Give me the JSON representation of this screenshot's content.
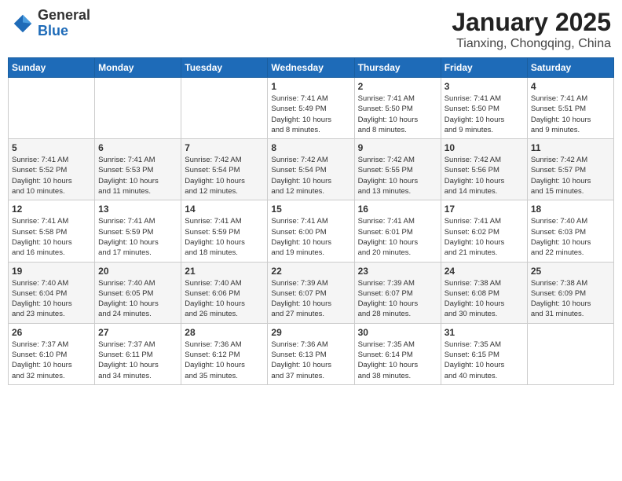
{
  "header": {
    "logo_general": "General",
    "logo_blue": "Blue",
    "title": "January 2025",
    "subtitle": "Tianxing, Chongqing, China"
  },
  "calendar": {
    "weekdays": [
      "Sunday",
      "Monday",
      "Tuesday",
      "Wednesday",
      "Thursday",
      "Friday",
      "Saturday"
    ],
    "weeks": [
      [
        {
          "day": "",
          "info": ""
        },
        {
          "day": "",
          "info": ""
        },
        {
          "day": "",
          "info": ""
        },
        {
          "day": "1",
          "info": "Sunrise: 7:41 AM\nSunset: 5:49 PM\nDaylight: 10 hours\nand 8 minutes."
        },
        {
          "day": "2",
          "info": "Sunrise: 7:41 AM\nSunset: 5:50 PM\nDaylight: 10 hours\nand 8 minutes."
        },
        {
          "day": "3",
          "info": "Sunrise: 7:41 AM\nSunset: 5:50 PM\nDaylight: 10 hours\nand 9 minutes."
        },
        {
          "day": "4",
          "info": "Sunrise: 7:41 AM\nSunset: 5:51 PM\nDaylight: 10 hours\nand 9 minutes."
        }
      ],
      [
        {
          "day": "5",
          "info": "Sunrise: 7:41 AM\nSunset: 5:52 PM\nDaylight: 10 hours\nand 10 minutes."
        },
        {
          "day": "6",
          "info": "Sunrise: 7:41 AM\nSunset: 5:53 PM\nDaylight: 10 hours\nand 11 minutes."
        },
        {
          "day": "7",
          "info": "Sunrise: 7:42 AM\nSunset: 5:54 PM\nDaylight: 10 hours\nand 12 minutes."
        },
        {
          "day": "8",
          "info": "Sunrise: 7:42 AM\nSunset: 5:54 PM\nDaylight: 10 hours\nand 12 minutes."
        },
        {
          "day": "9",
          "info": "Sunrise: 7:42 AM\nSunset: 5:55 PM\nDaylight: 10 hours\nand 13 minutes."
        },
        {
          "day": "10",
          "info": "Sunrise: 7:42 AM\nSunset: 5:56 PM\nDaylight: 10 hours\nand 14 minutes."
        },
        {
          "day": "11",
          "info": "Sunrise: 7:42 AM\nSunset: 5:57 PM\nDaylight: 10 hours\nand 15 minutes."
        }
      ],
      [
        {
          "day": "12",
          "info": "Sunrise: 7:41 AM\nSunset: 5:58 PM\nDaylight: 10 hours\nand 16 minutes."
        },
        {
          "day": "13",
          "info": "Sunrise: 7:41 AM\nSunset: 5:59 PM\nDaylight: 10 hours\nand 17 minutes."
        },
        {
          "day": "14",
          "info": "Sunrise: 7:41 AM\nSunset: 5:59 PM\nDaylight: 10 hours\nand 18 minutes."
        },
        {
          "day": "15",
          "info": "Sunrise: 7:41 AM\nSunset: 6:00 PM\nDaylight: 10 hours\nand 19 minutes."
        },
        {
          "day": "16",
          "info": "Sunrise: 7:41 AM\nSunset: 6:01 PM\nDaylight: 10 hours\nand 20 minutes."
        },
        {
          "day": "17",
          "info": "Sunrise: 7:41 AM\nSunset: 6:02 PM\nDaylight: 10 hours\nand 21 minutes."
        },
        {
          "day": "18",
          "info": "Sunrise: 7:40 AM\nSunset: 6:03 PM\nDaylight: 10 hours\nand 22 minutes."
        }
      ],
      [
        {
          "day": "19",
          "info": "Sunrise: 7:40 AM\nSunset: 6:04 PM\nDaylight: 10 hours\nand 23 minutes."
        },
        {
          "day": "20",
          "info": "Sunrise: 7:40 AM\nSunset: 6:05 PM\nDaylight: 10 hours\nand 24 minutes."
        },
        {
          "day": "21",
          "info": "Sunrise: 7:40 AM\nSunset: 6:06 PM\nDaylight: 10 hours\nand 26 minutes."
        },
        {
          "day": "22",
          "info": "Sunrise: 7:39 AM\nSunset: 6:07 PM\nDaylight: 10 hours\nand 27 minutes."
        },
        {
          "day": "23",
          "info": "Sunrise: 7:39 AM\nSunset: 6:07 PM\nDaylight: 10 hours\nand 28 minutes."
        },
        {
          "day": "24",
          "info": "Sunrise: 7:38 AM\nSunset: 6:08 PM\nDaylight: 10 hours\nand 30 minutes."
        },
        {
          "day": "25",
          "info": "Sunrise: 7:38 AM\nSunset: 6:09 PM\nDaylight: 10 hours\nand 31 minutes."
        }
      ],
      [
        {
          "day": "26",
          "info": "Sunrise: 7:37 AM\nSunset: 6:10 PM\nDaylight: 10 hours\nand 32 minutes."
        },
        {
          "day": "27",
          "info": "Sunrise: 7:37 AM\nSunset: 6:11 PM\nDaylight: 10 hours\nand 34 minutes."
        },
        {
          "day": "28",
          "info": "Sunrise: 7:36 AM\nSunset: 6:12 PM\nDaylight: 10 hours\nand 35 minutes."
        },
        {
          "day": "29",
          "info": "Sunrise: 7:36 AM\nSunset: 6:13 PM\nDaylight: 10 hours\nand 37 minutes."
        },
        {
          "day": "30",
          "info": "Sunrise: 7:35 AM\nSunset: 6:14 PM\nDaylight: 10 hours\nand 38 minutes."
        },
        {
          "day": "31",
          "info": "Sunrise: 7:35 AM\nSunset: 6:15 PM\nDaylight: 10 hours\nand 40 minutes."
        },
        {
          "day": "",
          "info": ""
        }
      ]
    ]
  }
}
